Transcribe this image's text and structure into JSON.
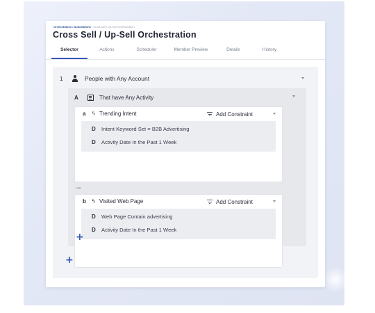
{
  "breadcrumb": {
    "path_prefix": "Orchestration / Automations",
    "path_rest": " / Cross-sell / Up-Sell Orchestration"
  },
  "page_title": "Cross Sell / Up-Sell Orchestration",
  "tabs": [
    {
      "label": "Selector",
      "active": true
    },
    {
      "label": "Actions",
      "active": false
    },
    {
      "label": "Scheduler",
      "active": false
    },
    {
      "label": "Member Preview",
      "active": false
    },
    {
      "label": "Details",
      "active": false
    },
    {
      "label": "History",
      "active": false
    }
  ],
  "rule": {
    "index": "1",
    "label": "People with Any Account",
    "icon": "person-icon",
    "group": {
      "letter": "A",
      "label": "That have Any Activity",
      "icon": "building-icon",
      "constraints": [
        {
          "letter": "a",
          "title": "Trending Intent",
          "add_label": "Add Constraint",
          "conditions": [
            {
              "icon": "D",
              "text": "Intent Keyword Set = B2B Advertising"
            },
            {
              "icon": "D",
              "text": "Activity Date In the Past 1 Week"
            }
          ]
        },
        {
          "letter": "b",
          "title": "Visited Web Page",
          "add_label": "Add Constraint",
          "conditions": [
            {
              "icon": "D",
              "text": "Web Page Contain advertising"
            },
            {
              "icon": "D",
              "text": "Activity Date In the Past 1 Week"
            }
          ]
        }
      ],
      "connector": "OR",
      "add_symbol": "+"
    },
    "add_symbol": "+"
  },
  "colors": {
    "accent": "#3657b6",
    "plus": "#2f55b3",
    "frame_bg": "#e3e8f6",
    "panel_bg": "#f2f3f6",
    "group_bg": "#e7e8ec"
  }
}
